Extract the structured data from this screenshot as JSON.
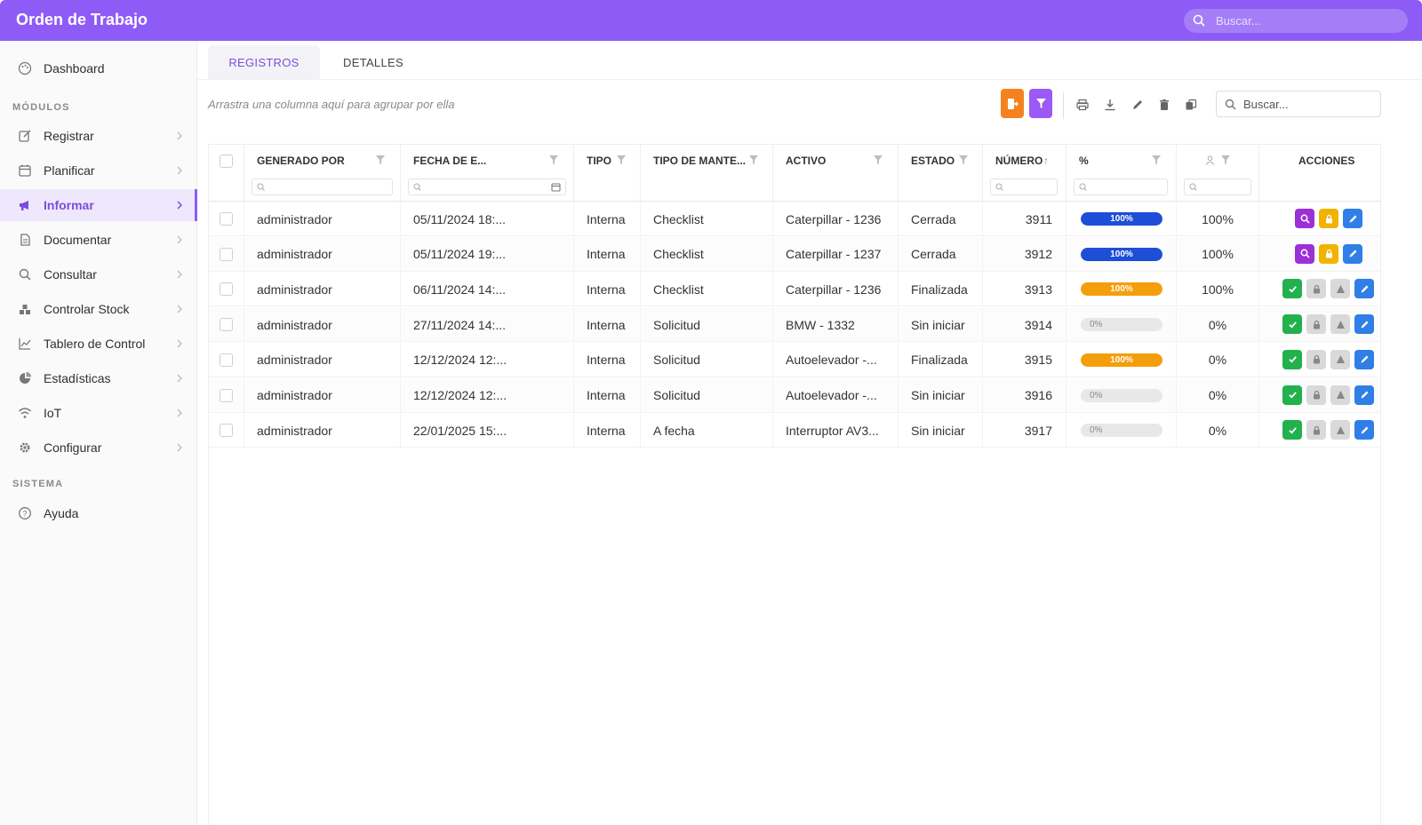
{
  "header": {
    "title": "Orden de Trabajo",
    "search_placeholder": "Buscar..."
  },
  "sidebar": {
    "dashboard": {
      "label": "Dashboard",
      "icon": "palette-icon"
    },
    "section_modulos": "MÓDULOS",
    "items": [
      {
        "label": "Registrar",
        "icon": "edit-icon"
      },
      {
        "label": "Planificar",
        "icon": "calendar-icon"
      },
      {
        "label": "Informar",
        "icon": "megaphone-icon",
        "active": true
      },
      {
        "label": "Documentar",
        "icon": "document-icon"
      },
      {
        "label": "Consultar",
        "icon": "search-icon"
      },
      {
        "label": "Controlar Stock",
        "icon": "warehouse-icon"
      },
      {
        "label": "Tablero de Control",
        "icon": "line-chart-icon"
      },
      {
        "label": "Estadísticas",
        "icon": "pie-chart-icon"
      },
      {
        "label": "IoT",
        "icon": "wifi-icon"
      },
      {
        "label": "Configurar",
        "icon": "gear-icon"
      }
    ],
    "section_sistema": "SISTEMA",
    "help": {
      "label": "Ayuda",
      "icon": "help-icon"
    }
  },
  "tabs": [
    {
      "label": "REGISTROS",
      "active": true
    },
    {
      "label": "DETALLES",
      "active": false
    }
  ],
  "toolbar": {
    "group_hint": "Arrastra una columna aquí para agrupar por ella",
    "search_placeholder": "Buscar...",
    "colors": {
      "orange": "#f58220",
      "purple": "#9b59f5"
    }
  },
  "grid": {
    "columns": [
      "GENERADO POR",
      "FECHA DE E...",
      "TIPO",
      "TIPO DE MANTE...",
      "ACTIVO",
      "ESTADO",
      "NÚMERO",
      "%",
      "",
      "ACCIONES"
    ],
    "sort_indicator": "↑",
    "rows": [
      {
        "generado_por": "administrador",
        "fecha": "05/11/2024 18:...",
        "tipo": "Interna",
        "tipo_mant": "Checklist",
        "activo": "Caterpillar - 1236",
        "estado": "Cerrada",
        "numero": "3911",
        "progress": 100,
        "progress_label": "100%",
        "progress_color": "#1d4ed8",
        "pct": "100%",
        "actions": "closed"
      },
      {
        "generado_por": "administrador",
        "fecha": "05/11/2024 19:...",
        "tipo": "Interna",
        "tipo_mant": "Checklist",
        "activo": "Caterpillar - 1237",
        "estado": "Cerrada",
        "numero": "3912",
        "progress": 100,
        "progress_label": "100%",
        "progress_color": "#1d4ed8",
        "pct": "100%",
        "actions": "closed"
      },
      {
        "generado_por": "administrador",
        "fecha": "06/11/2024 14:...",
        "tipo": "Interna",
        "tipo_mant": "Checklist",
        "activo": "Caterpillar - 1236",
        "estado": "Finalizada",
        "numero": "3913",
        "progress": 100,
        "progress_label": "100%",
        "progress_color": "#f59e0b",
        "pct": "100%",
        "actions": "open"
      },
      {
        "generado_por": "administrador",
        "fecha": "27/11/2024 14:...",
        "tipo": "Interna",
        "tipo_mant": "Solicitud",
        "activo": "BMW - 1332",
        "estado": "Sin iniciar",
        "numero": "3914",
        "progress": 0,
        "progress_label": "0%",
        "progress_color": "#e8e8e8",
        "pct": "0%",
        "actions": "open"
      },
      {
        "generado_por": "administrador",
        "fecha": "12/12/2024 12:...",
        "tipo": "Interna",
        "tipo_mant": "Solicitud",
        "activo": "Autoelevador -...",
        "estado": "Finalizada",
        "numero": "3915",
        "progress": 100,
        "progress_label": "100%",
        "progress_color": "#f59e0b",
        "pct": "0%",
        "actions": "open"
      },
      {
        "generado_por": "administrador",
        "fecha": "12/12/2024 12:...",
        "tipo": "Interna",
        "tipo_mant": "Solicitud",
        "activo": "Autoelevador -...",
        "estado": "Sin iniciar",
        "numero": "3916",
        "progress": 0,
        "progress_label": "0%",
        "progress_color": "#e8e8e8",
        "pct": "0%",
        "actions": "open"
      },
      {
        "generado_por": "administrador",
        "fecha": "22/01/2025 15:...",
        "tipo": "Interna",
        "tipo_mant": "A fecha",
        "activo": "Interruptor AV3...",
        "estado": "Sin iniciar",
        "numero": "3917",
        "progress": 0,
        "progress_label": "0%",
        "progress_color": "#e8e8e8",
        "pct": "0%",
        "actions": "open"
      }
    ],
    "action_colors": {
      "view": "#9b30d9",
      "lock": "#f0b400",
      "edit": "#2f7fe6",
      "approve": "#22b14c",
      "disabled": "#d9d9d9"
    }
  }
}
